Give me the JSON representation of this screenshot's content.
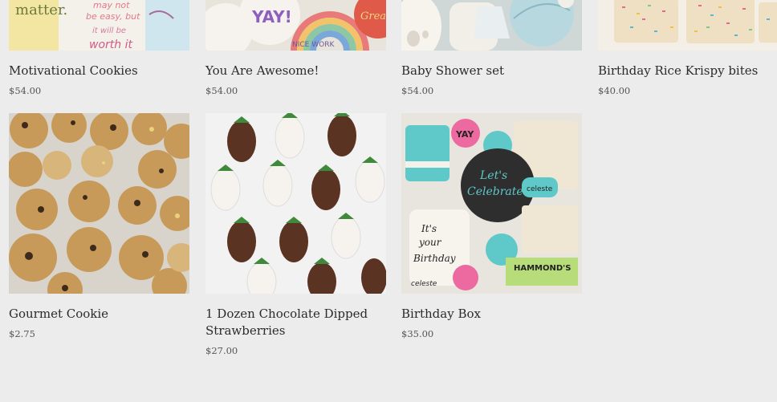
{
  "products": [
    {
      "name": "Motivational Cookies",
      "price": "$54.00"
    },
    {
      "name": "You Are Awesome!",
      "price": "$54.00"
    },
    {
      "name": "Baby Shower set",
      "price": "$54.00"
    },
    {
      "name": "Birthday Rice Krispy bites",
      "price": "$40.00"
    },
    {
      "name": "Gourmet Cookie",
      "price": "$2.75"
    },
    {
      "name": "1 Dozen Chocolate Dipped Strawberries",
      "price": "$27.00"
    },
    {
      "name": "Birthday Box",
      "price": "$35.00"
    }
  ],
  "image_text": {
    "motivational": [
      "matter.",
      "may not",
      "be easy, but",
      "it will be",
      "worth it"
    ],
    "awesome": [
      "YAY!",
      "NICE WORK",
      "Great Job"
    ],
    "birthday_box": [
      "Let's",
      "Celebrate",
      "It's",
      "your",
      "Birthday",
      "YAY",
      "celeste",
      "HAMMOND'S"
    ]
  },
  "colors": {
    "background": "#ececec",
    "text": "#2b2b2b",
    "price": "#555555"
  }
}
